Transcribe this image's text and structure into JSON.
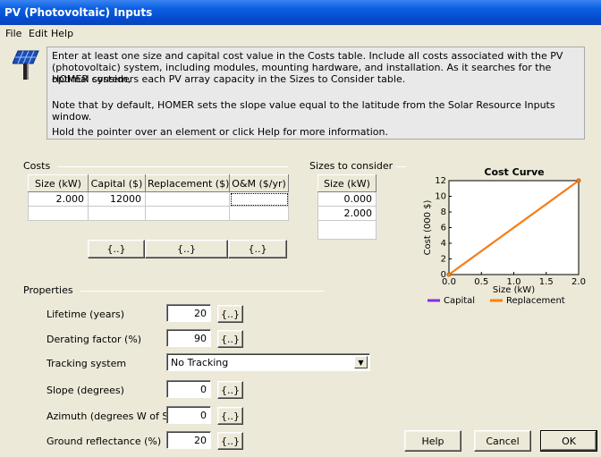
{
  "window": {
    "title": "PV (Photovoltaic) Inputs"
  },
  "menu": [
    "File",
    "Edit",
    "Help"
  ],
  "icon": "solar-panel-icon",
  "intro": {
    "p1_line1": "Enter at least one size and capital cost value in the Costs table.  Include all costs associated with the PV",
    "p1_line2": "(photovoltaic) system, including modules, mounting hardware, and installation. As it searches for the optimal system,",
    "p1_line3": "HOMER considers each PV array capacity in the Sizes to Consider table.",
    "p2": "Note that by default, HOMER sets the slope value equal to the latitude from the Solar Resource Inputs window.",
    "p3": "Hold the pointer over an element or click Help for more information."
  },
  "costs": {
    "label": "Costs",
    "headers": [
      "Size (kW)",
      "Capital ($)",
      "Replacement ($)",
      "O&M ($/yr)"
    ],
    "rows": [
      [
        "2.000",
        "12000",
        "",
        ""
      ],
      [
        "",
        "",
        "",
        ""
      ]
    ],
    "sens_buttons": [
      "{..}",
      "{..}",
      "{..}"
    ]
  },
  "sizes": {
    "label": "Sizes to consider",
    "header": "Size (kW)",
    "rows": [
      "0.000",
      "2.000",
      ""
    ]
  },
  "chart_data": {
    "type": "line",
    "title": "Cost Curve",
    "xlabel": "Size (kW)",
    "ylabel": "Cost (000 $)",
    "xlim": [
      0,
      2
    ],
    "ylim": [
      0,
      12
    ],
    "xticks": [
      "0.0",
      "0.5",
      "1.0",
      "1.5",
      "2.0"
    ],
    "yticks": [
      "0",
      "2",
      "4",
      "6",
      "8",
      "10",
      "12"
    ],
    "series": [
      {
        "name": "Capital",
        "color": "#8a2be2",
        "x": [
          0,
          2
        ],
        "y": [
          0,
          12
        ]
      },
      {
        "name": "Replacement",
        "color": "#ff8000",
        "x": [
          0,
          2
        ],
        "y": [
          0,
          12
        ]
      }
    ],
    "legend": "bottom",
    "grid": false
  },
  "properties": {
    "label": "Properties",
    "lifetime": {
      "label": "Lifetime (years)",
      "value": "20"
    },
    "derating": {
      "label": "Derating factor (%)",
      "value": "90"
    },
    "tracking": {
      "label": "Tracking system",
      "value": "No Tracking"
    },
    "slope": {
      "label": "Slope (degrees)",
      "value": "0"
    },
    "azimuth": {
      "label": "Azimuth (degrees W of S)",
      "value": "0"
    },
    "ground": {
      "label": "Ground reflectance (%)",
      "value": "20"
    },
    "sens_label": "{..}"
  },
  "buttons": {
    "help": "Help",
    "cancel": "Cancel",
    "ok": "OK"
  }
}
